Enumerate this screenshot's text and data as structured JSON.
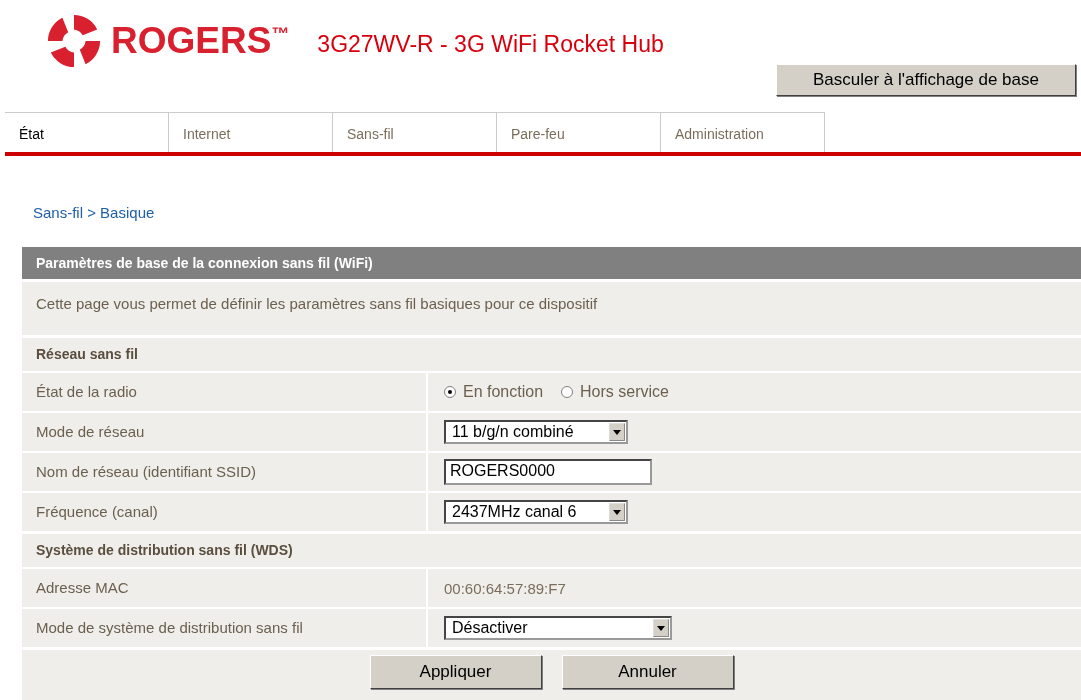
{
  "header": {
    "brand": "ROGERS$^{™}$",
    "model": "3G27WV-R - 3G WiFi Rocket Hub",
    "switch_button": "Basculer à l'affichage de base"
  },
  "tabs": [
    {
      "label": "État",
      "selected": true
    },
    {
      "label": "Internet",
      "selected": false
    },
    {
      "label": "Sans-fil",
      "selected": false
    },
    {
      "label": "Pare-feu",
      "selected": false
    },
    {
      "label": "Administration",
      "selected": false
    }
  ],
  "breadcrumb": "Sans-fil > Basique",
  "panel": {
    "title": "Paramètres de base de la connexion sans fil (WiFi)",
    "description": "Cette page vous permet de définir les paramètres sans fil basiques pour ce dispositif",
    "rows": [
      {
        "kind": "section",
        "label": "Réseau sans fil"
      },
      {
        "kind": "radio",
        "label": "État de la radio",
        "options": [
          {
            "label": "En fonction",
            "selected": true
          },
          {
            "label": "Hors service",
            "selected": false
          }
        ]
      },
      {
        "kind": "select",
        "label": "Mode de réseau",
        "value": "11 b/g/n combiné"
      },
      {
        "kind": "input",
        "label": "Nom de réseau (identifiant SSID)",
        "value": "ROGERS0000"
      },
      {
        "kind": "select",
        "label": "Fréquence (canal)",
        "value": "2437MHz canal 6"
      },
      {
        "kind": "section",
        "label": "Système de distribution sans fil (WDS)"
      },
      {
        "kind": "text",
        "label": "Adresse MAC",
        "value": "00:60:64:57:89:F7"
      },
      {
        "kind": "select",
        "label": "Mode de système de distribution sans fil",
        "value": "Désactiver",
        "wide": true
      }
    ],
    "buttons": [
      "Appliquer",
      "Annuler"
    ]
  }
}
